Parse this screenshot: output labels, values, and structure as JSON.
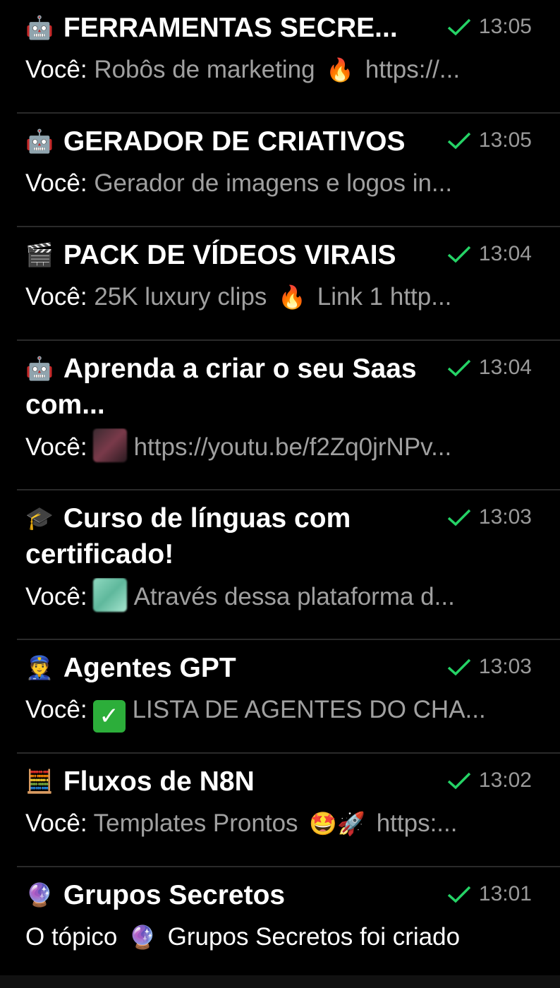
{
  "chats": [
    {
      "icon": "robot-emoji-icon",
      "icon_glyph": "🤖",
      "title": "FERRAMENTAS SECRE...",
      "time": "13:05",
      "sender": "Você:",
      "preview": "Robôs de marketing",
      "preview_emoji": "🔥",
      "preview_tail": "https://..."
    },
    {
      "icon": "robot-emoji-icon",
      "icon_glyph": "🤖",
      "title": "GERADOR DE CRIATIVOS",
      "time": "13:05",
      "sender": "Você:",
      "preview": "Gerador de imagens e logos in..."
    },
    {
      "icon": "clapper-board-icon",
      "icon_glyph": "🎬",
      "title": "PACK DE VÍDEOS VIRAIS",
      "time": "13:04",
      "sender": "Você:",
      "preview": "25K luxury clips",
      "preview_emoji": "🔥",
      "preview_tail": "Link 1  http..."
    },
    {
      "icon": "robot-emoji-icon",
      "icon_glyph": "🤖",
      "title": "Aprenda a criar o seu Saas com...",
      "time": "13:04",
      "sender": "Você:",
      "preview": "https://youtu.be/f2Zq0jrNPv..."
    },
    {
      "icon": "graduation-cap-icon",
      "icon_glyph": "🎓",
      "title": "Curso de línguas com certificado!",
      "time": "13:03",
      "sender": "Você:",
      "preview": "Através dessa plataforma d..."
    },
    {
      "icon": "police-officer-icon",
      "icon_glyph": "👮",
      "title": "Agentes GPT",
      "time": "13:03",
      "sender": "Você:",
      "preview": "LISTA DE AGENTES DO CHA..."
    },
    {
      "icon": "abacus-icon",
      "icon_glyph": "🧮",
      "title": "Fluxos de N8N",
      "time": "13:02",
      "sender": "Você:",
      "preview": "Templates Prontos",
      "preview_emoji": "🤩🚀",
      "preview_tail": "https:..."
    },
    {
      "icon": "crystal-ball-icon",
      "icon_glyph": "🔮",
      "title": "Grupos Secretos",
      "time": "13:01",
      "system_preview_a": "O tópico",
      "system_preview_emoji": "🔮",
      "system_preview_b": "Grupos Secretos foi criado"
    }
  ],
  "colors": {
    "background": "#000000",
    "check_green": "#25d366",
    "divider": "#2a2a2a",
    "secondary_text": "#a0a0a0"
  }
}
